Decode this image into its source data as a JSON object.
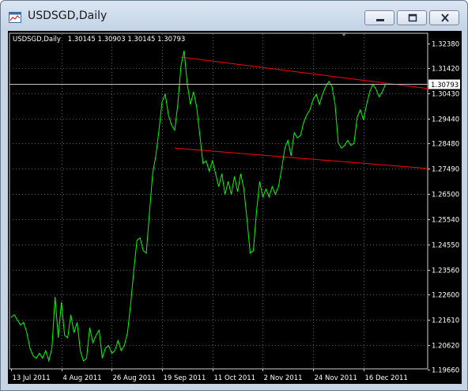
{
  "window": {
    "title": "USDSGD,Daily",
    "icon": "chart-window-icon",
    "buttons": {
      "minimize": "minimize-icon",
      "maximize": "maximize-icon",
      "close": "close-icon"
    }
  },
  "header": {
    "symbol": "USDSGD,Daily",
    "ohlc": "1.30145 1.30903 1.30145 1.30793"
  },
  "current_price": "1.30793",
  "colors": {
    "background": "#000000",
    "grid": "#5a5a5a",
    "price_line": "#00ff00",
    "trend_lines": "#ff0000",
    "text": "#ffffff"
  },
  "chart_data": {
    "type": "line",
    "grid": true,
    "ylim": [
      1.1966,
      1.3238
    ],
    "y_ticks": [
      "1.32380",
      "1.31420",
      "1.30430",
      "1.29440",
      "1.28480",
      "1.27490",
      "1.26500",
      "1.25540",
      "1.24550",
      "1.23560",
      "1.22600",
      "1.21610",
      "1.20620",
      "1.19660"
    ],
    "x_ticks": [
      "13 Jul 2011",
      "4 Aug 2011",
      "26 Aug 2011",
      "19 Sep 2011",
      "11 Oct 2011",
      "2 Nov 2011",
      "24 Nov 2011",
      "16 Dec 2011"
    ],
    "x_tick_bar_index": [
      0,
      16,
      32,
      48,
      64,
      80,
      96,
      112
    ],
    "series": [
      {
        "values": [
          1.217,
          1.218,
          1.216,
          1.214,
          1.215,
          1.211,
          1.205,
          1.202,
          1.201,
          1.203,
          1.201,
          1.204,
          1.2,
          1.205,
          1.225,
          1.209,
          1.223,
          1.21,
          1.209,
          1.218,
          1.211,
          1.215,
          1.204,
          1.2,
          1.201,
          1.213,
          1.207,
          1.21,
          1.212,
          1.201,
          1.205,
          1.206,
          1.203,
          1.204,
          1.208,
          1.204,
          1.206,
          1.211,
          1.222,
          1.235,
          1.247,
          1.248,
          1.243,
          1.242,
          1.258,
          1.273,
          1.28,
          1.29,
          1.301,
          1.304,
          1.296,
          1.292,
          1.29,
          1.3,
          1.315,
          1.321,
          1.308,
          1.3,
          1.305,
          1.299,
          1.288,
          1.277,
          1.278,
          1.274,
          1.278,
          1.273,
          1.268,
          1.273,
          1.265,
          1.27,
          1.265,
          1.272,
          1.266,
          1.273,
          1.267,
          1.255,
          1.242,
          1.243,
          1.258,
          1.27,
          1.264,
          1.267,
          1.264,
          1.268,
          1.265,
          1.268,
          1.275,
          1.283,
          1.286,
          1.28,
          1.289,
          1.287,
          1.288,
          1.293,
          1.296,
          1.298,
          1.302,
          1.304,
          1.3,
          1.304,
          1.307,
          1.309,
          1.307,
          1.3,
          1.285,
          1.283,
          1.284,
          1.286,
          1.284,
          1.285,
          1.295,
          1.298,
          1.294,
          1.3,
          1.305,
          1.308,
          1.306,
          1.303,
          1.305,
          1.3079
        ]
      }
    ],
    "trend_lines": [
      {
        "from": {
          "bar": 54,
          "value": 1.3185
        },
        "to": {
          "bar": 134,
          "value": 1.306
        }
      },
      {
        "from": {
          "bar": 52,
          "value": 1.283
        },
        "to": {
          "bar": 134,
          "value": 1.2749
        }
      }
    ]
  }
}
